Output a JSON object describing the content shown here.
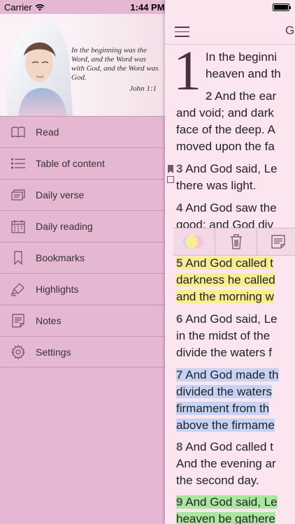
{
  "status": {
    "carrier": "Carrier",
    "time": "1:44 PM"
  },
  "sidebar": {
    "quote": "In the beginning was the Word, and the Word was with God, and the Word was God.",
    "quote_ref": "John 1:1",
    "items": [
      {
        "label": "Read",
        "icon": "book-open-icon"
      },
      {
        "label": "Table of content",
        "icon": "list-icon"
      },
      {
        "label": "Daily verse",
        "icon": "cards-icon"
      },
      {
        "label": "Daily reading",
        "icon": "calendar-icon"
      },
      {
        "label": "Bookmarks",
        "icon": "bookmark-icon"
      },
      {
        "label": "Highlights",
        "icon": "highlighter-icon"
      },
      {
        "label": "Notes",
        "icon": "note-icon"
      },
      {
        "label": "Settings",
        "icon": "gear-icon"
      }
    ]
  },
  "reader": {
    "nav_title": "G",
    "chapter_number": "1",
    "lines": [
      {
        "text": "In the beginni",
        "num": ""
      },
      {
        "text": "heaven and th",
        "num": ""
      },
      {
        "text": " And the ear",
        "num": "2"
      },
      {
        "text": "and void; and dark",
        "num": ""
      },
      {
        "text": "face of the deep. A",
        "num": ""
      },
      {
        "text": "moved upon the fa",
        "num": ""
      },
      {
        "text": " And God said, Le",
        "num": "3"
      },
      {
        "text": "there was light.",
        "num": ""
      },
      {
        "text": " And God saw the",
        "num": "4"
      },
      {
        "text": "good: and God div",
        "num": ""
      },
      {
        "text": " And God called t",
        "num": "5",
        "hl": "yellow"
      },
      {
        "text": "darkness he called",
        "num": "",
        "hl": "yellow"
      },
      {
        "text": "and the morning w",
        "num": "",
        "hl": "yellow"
      },
      {
        "text": " And God said, Le",
        "num": "6"
      },
      {
        "text": "in the midst of the",
        "num": ""
      },
      {
        "text": "divide the waters f",
        "num": ""
      },
      {
        "text": " And God made th",
        "num": "7",
        "hl": "blue"
      },
      {
        "text": "divided the waters",
        "num": "",
        "hl": "blue"
      },
      {
        "text": "firmament from th",
        "num": "",
        "hl": "blue"
      },
      {
        "text": "above the firmame",
        "num": "",
        "hl": "blue"
      },
      {
        "text": " And God called t",
        "num": "8"
      },
      {
        "text": "And the evening ar",
        "num": ""
      },
      {
        "text": "the second day.",
        "num": ""
      },
      {
        "text": " And God said, Le",
        "num": "9",
        "hl": "green"
      },
      {
        "text": "heaven be gathere",
        "num": "",
        "hl": "green"
      }
    ],
    "toolbar": [
      {
        "icon": "color-palette-icon"
      },
      {
        "icon": "trash-icon"
      },
      {
        "icon": "note-icon"
      }
    ]
  },
  "colors": {
    "sidebar_bg": "#e5b7d2",
    "reader_bg": "#fbe6ef",
    "highlight_yellow": "#f7ee8f",
    "highlight_blue": "#c6d3f6",
    "highlight_green": "#a9e79f"
  }
}
